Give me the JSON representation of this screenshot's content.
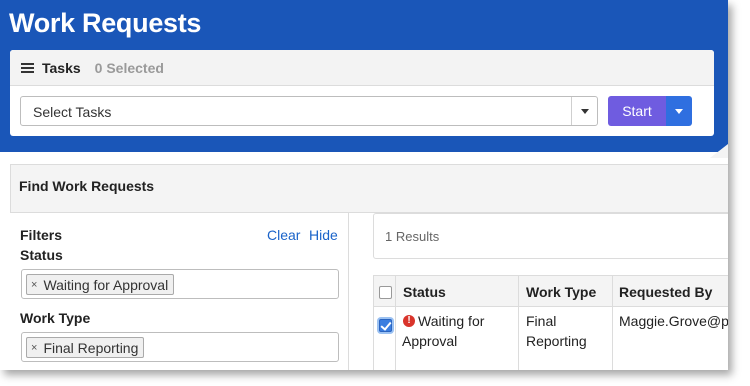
{
  "header": {
    "title": "Work Requests",
    "bg_color": "#1a56b8"
  },
  "tasks": {
    "title": "Tasks",
    "selected_text": "0 Selected",
    "select_placeholder": "Select Tasks",
    "start_label": "Start",
    "start_color": "#6f5ce0",
    "icon": "list-icon"
  },
  "find": {
    "title": "Find Work Requests",
    "filters": {
      "title": "Filters",
      "clear_label": "Clear",
      "hide_label": "Hide",
      "status_label": "Status",
      "status_chip": "Waiting for Approval",
      "work_type_label": "Work Type",
      "work_type_chip": "Final Reporting",
      "chip_remove": "×"
    },
    "results_text": "1 Results",
    "table": {
      "columns": [
        "Status",
        "Work Type",
        "Requested By"
      ],
      "rows": [
        {
          "checked": true,
          "status_line1": "Waiting for",
          "status_line2": "Approval",
          "work_type_line1": "Final",
          "work_type_line2": "Reporting",
          "requested_by": "Maggie.Grove@p"
        }
      ]
    }
  }
}
